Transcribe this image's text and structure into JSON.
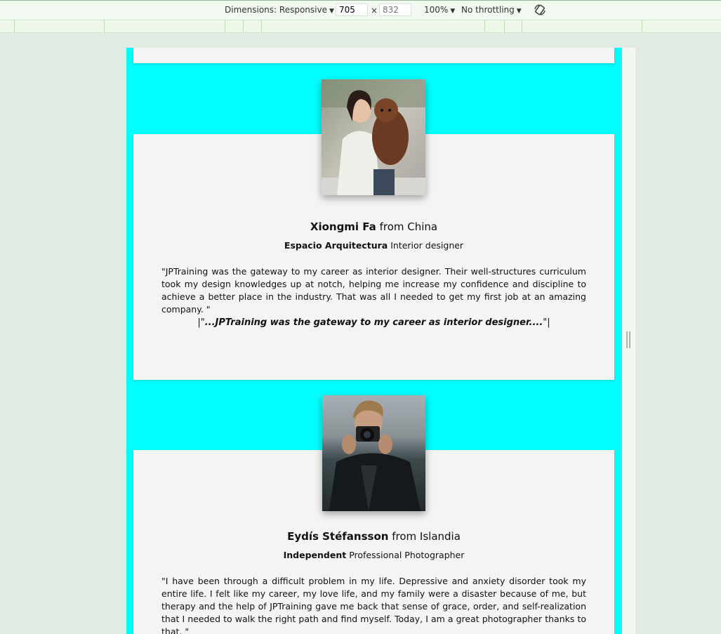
{
  "toolbar": {
    "dimensions_label": "Dimensions: Responsive",
    "width_value": "705",
    "times": "×",
    "height_placeholder": "832",
    "zoom": "100%",
    "throttling": "No throttling"
  },
  "testimonials": [
    {
      "name": "Xiongmi Fa",
      "from": "from China",
      "company": "Espacio Arquitectura",
      "role": "Interior designer",
      "quote": "\"JPTraining was the gateway to my career as interior designer. Their well-structures curriculum took my design knowledges up at notch, helping me increase my confidence and discipline to achieve a better place in the industry. That was all I needed to get my first job at an amazing company. \"",
      "highlight_open": "|\"",
      "highlight": "...JPTraining was the gateway to my career as interior designer....",
      "highlight_close": "\"|"
    },
    {
      "name": "Eydís Stéfansson",
      "from": "from Islandia",
      "company": "Independent",
      "role": "Professional Photographer",
      "quote": "\"I have been through a difficult problem in my life. Depressive and anxiety disorder took my entire life. I felt like my career, my love life, and my family were a disaster because of me, but therapy and the help of JPTraining gave me back that sense of grace, order, and self-realization that I needed to walk the right path and find myself. Today, I am a great photographer thanks to that. \""
    }
  ],
  "colors": {
    "page_background": "#00ffff",
    "card_background": "#f4f4f4",
    "devtools_background": "#e2ebe1"
  }
}
